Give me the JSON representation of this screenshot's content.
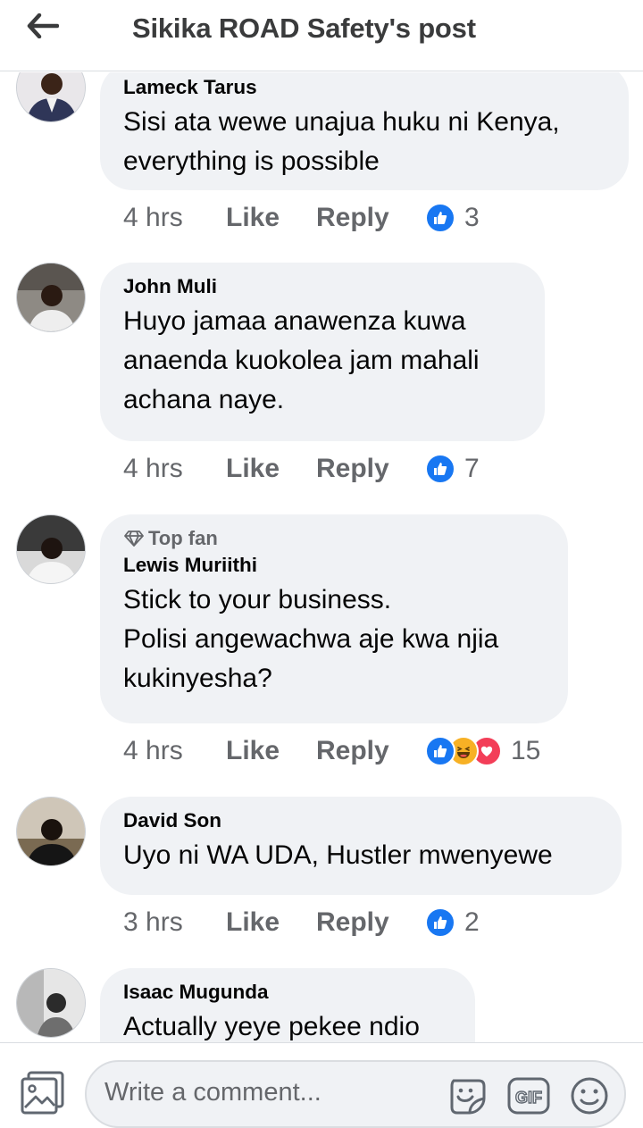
{
  "header": {
    "title": "Sikika ROAD Safety's post"
  },
  "comments": [
    {
      "author": "Lameck Tarus",
      "badge": "",
      "text": "Sisi ata wewe unajua huku ni Kenya,\neverything is possible",
      "time": "4 hrs",
      "like": "Like",
      "reply": "Reply",
      "reactions": [
        "like"
      ],
      "count": "3"
    },
    {
      "author": "John Muli",
      "badge": "",
      "text": "Huyo jamaa anawenza kuwa\nanaenda kuokolea jam mahali\nachana naye.",
      "time": "4 hrs",
      "like": "Like",
      "reply": "Reply",
      "reactions": [
        "like"
      ],
      "count": "7"
    },
    {
      "author": "Lewis Muriithi",
      "badge": "Top fan",
      "text": "Stick to your business.\nPolisi angewachwa aje kwa njia\nkukinyesha?",
      "time": "4 hrs",
      "like": "Like",
      "reply": "Reply",
      "reactions": [
        "like",
        "haha",
        "love"
      ],
      "count": "15"
    },
    {
      "author": "David Son",
      "badge": "",
      "text": "Uyo ni WA UDA, Hustler mwenyewe",
      "time": "3 hrs",
      "like": "Like",
      "reply": "Reply",
      "reactions": [
        "like"
      ],
      "count": "2"
    },
    {
      "author": "Isaac Mugunda",
      "badge": "",
      "text": "Actually yeye pekee ndio",
      "time": "",
      "like": "",
      "reply": "",
      "reactions": [],
      "count": ""
    }
  ],
  "composer": {
    "placeholder": "Write a comment..."
  },
  "icons": {
    "back": "arrow-left-icon",
    "top_fan": "diamond-icon",
    "photo": "photo-icon",
    "sticker": "sticker-icon",
    "gif": "gif-icon",
    "emoji": "emoji-icon"
  },
  "colors": {
    "like_blue": "#1877f2",
    "haha_yellow": "#f7b125",
    "love_red": "#f33e58",
    "bubble": "#f0f2f5",
    "secondary_text": "#65676b"
  }
}
